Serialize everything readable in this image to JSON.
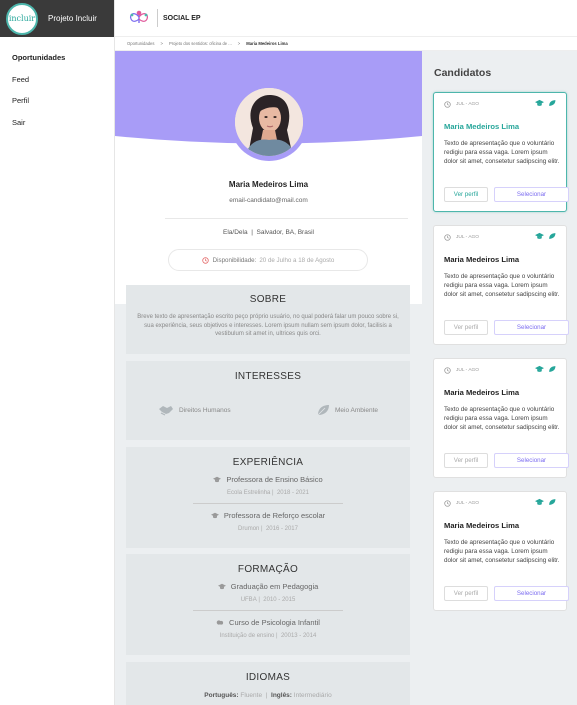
{
  "brand": {
    "logo_text": "incluir",
    "name": "Projeto Incluir"
  },
  "nav": [
    "Oportunidades",
    "Feed",
    "Perfil",
    "Sair"
  ],
  "header": {
    "title": "SOCIAL EP"
  },
  "breadcrumb": [
    "Oportunidades",
    "Projeto dos sentidos: oficina de ...",
    "Maria Medeiros Lima"
  ],
  "profile": {
    "name": "Maria Medeiros Lima",
    "email": "email-candidato@mail.com",
    "pronouns": "Ela/Dela",
    "location": "Salvador, BA, Brasil",
    "availability_label": "Disponibilidade:",
    "availability_value": "20 de Julho a 18 de Agosto"
  },
  "about": {
    "title": "SOBRE",
    "text": "Breve texto de apresentação escrito peço próprio usuário, no qual poderá falar um pouco sobre si, sua experiência, seus objetivos e interesses. Lorem ipsum nullam sem ipsum dolor, facilisis a vestibulum sit amet in, ultrices quis orci."
  },
  "interests": {
    "title": "INTERESSES",
    "items": [
      "Direitos Humanos",
      "Meio Ambiente"
    ]
  },
  "experience": {
    "title": "EXPERIÊNCIA",
    "items": [
      {
        "role": "Professora de Ensino Básico",
        "place": "Ecola Estrelinha",
        "period": "2018 - 2021"
      },
      {
        "role": "Professora de Reforço escolar",
        "place": "Drumon",
        "period": "2016 - 2017"
      }
    ]
  },
  "education": {
    "title": "FORMAÇÃO",
    "items": [
      {
        "course": "Graduação em Pedagogia",
        "place": "UFBA",
        "period": "2010 - 2015"
      },
      {
        "course": "Curso de Psicologia Infantil",
        "place": "Instituição de ensino",
        "period": "20013 - 2014"
      }
    ]
  },
  "languages": {
    "title": "IDIOMAS",
    "items": [
      {
        "lang": "Português:",
        "level": "Fluente"
      },
      {
        "lang": "Inglês:",
        "level": "Intermediário"
      }
    ]
  },
  "candidates": {
    "title": "Candidatos",
    "cards": [
      {
        "period": "JUL - AGO",
        "name": "Maria Medeiros Lima",
        "text": "Texto de apresentação que o voluntário redigiu para essa vaga. Lorem ipsum dolor sit amet, consetetur sadipscing elitr.",
        "view": "Ver perfil",
        "select": "Selecionar"
      },
      {
        "period": "JUL - AGO",
        "name": "Maria Medeiros Lima",
        "text": "Texto de apresentação que o voluntário redigiu para essa vaga. Lorem ipsum dolor sit amet, consetetur sadipscing elitr.",
        "view": "Ver perfil",
        "select": "Selecionar"
      },
      {
        "period": "JUL - AGO",
        "name": "Maria Medeiros Lima",
        "text": "Texto de apresentação que o voluntário redigiu para essa vaga. Lorem ipsum dolor sit amet, consetetur sadipscing elitr.",
        "view": "Ver perfil",
        "select": "Selecionar"
      },
      {
        "period": "JUL - AGO",
        "name": "Maria Medeiros Lima",
        "text": "Texto de apresentação que o voluntário redigiu para essa vaga. Lorem ipsum dolor sit amet, consetetur sadipscing elitr.",
        "view": "Ver perfil",
        "select": "Selecionar"
      }
    ]
  },
  "colors": {
    "accent": "#a89cf7",
    "teal": "#26a69a",
    "select": "#7c6df0"
  },
  "icons": [
    "clock-icon",
    "graduation-cap-icon",
    "leaf-icon",
    "handshake-icon"
  ]
}
